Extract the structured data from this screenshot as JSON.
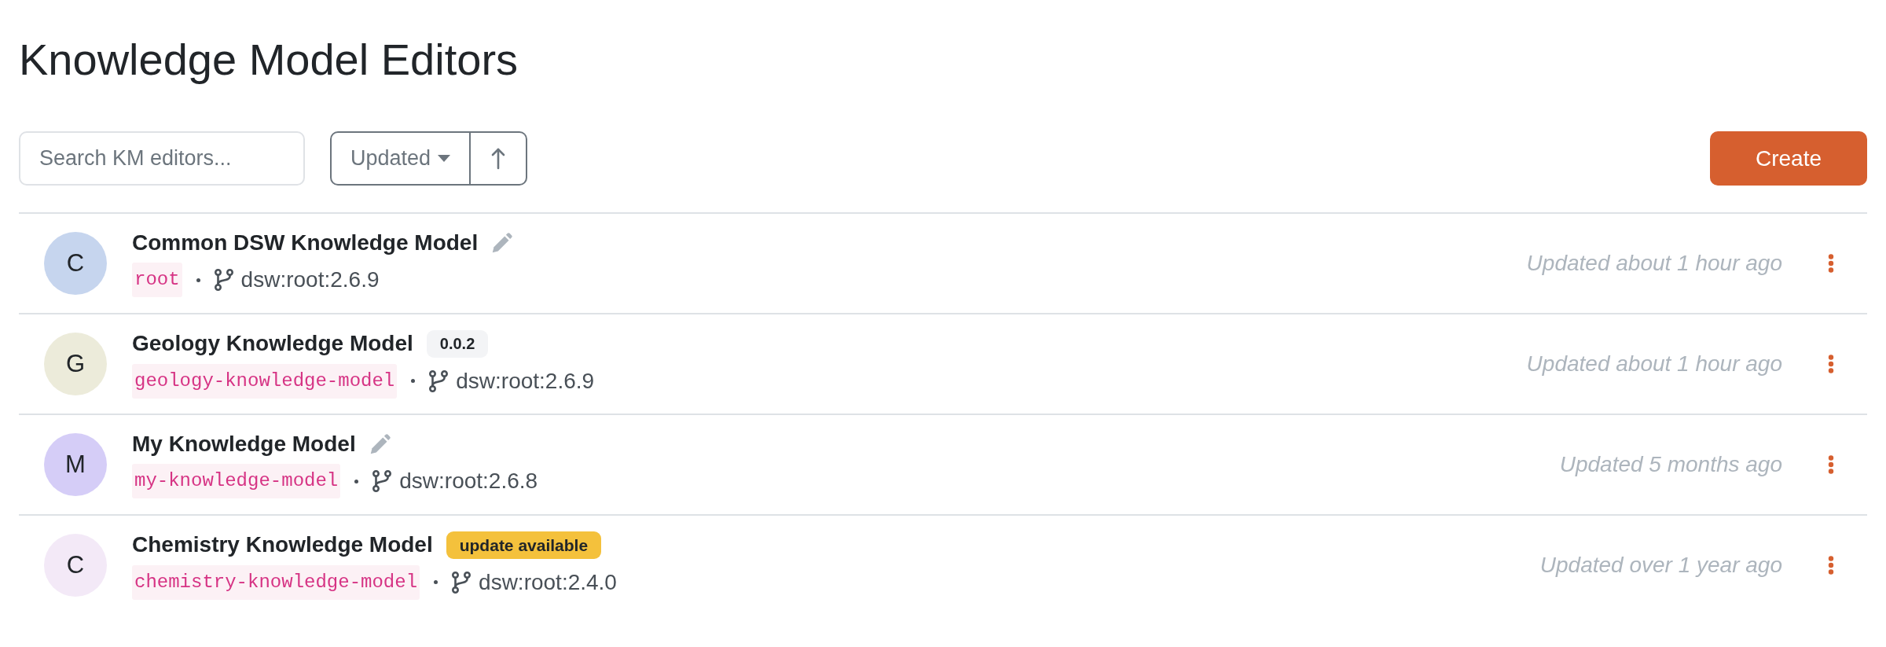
{
  "page_title": "Knowledge Model Editors",
  "toolbar": {
    "search": {
      "placeholder": "Search KM editors..."
    },
    "sort": {
      "field": "Updated"
    },
    "create_button": "Create"
  },
  "editors": [
    {
      "initial": "C",
      "color": "#c6d5ee",
      "name": "Common DSW Knowledge Model",
      "edited": true,
      "km_id": "root",
      "parent": "dsw:root:2.6.9",
      "updated": "Updated about 1 hour ago"
    },
    {
      "initial": "G",
      "color": "#ecebda",
      "name": "Geology Knowledge Model",
      "edited": false,
      "badge": {
        "kind": "version",
        "text": "0.0.2"
      },
      "km_id": "geology-knowledge-model",
      "parent": "dsw:root:2.6.9",
      "updated": "Updated about 1 hour ago"
    },
    {
      "initial": "M",
      "color": "#d5cdf7",
      "name": "My Knowledge Model",
      "edited": true,
      "km_id": "my-knowledge-model",
      "parent": "dsw:root:2.6.8",
      "updated": "Updated 5 months ago"
    },
    {
      "initial": "C",
      "color": "#f3e9f7",
      "name": "Chemistry Knowledge Model",
      "edited": false,
      "badge": {
        "kind": "warning",
        "text": "update available"
      },
      "km_id": "chemistry-knowledge-model",
      "parent": "dsw:root:2.4.0",
      "updated": "Updated over 1 year ago"
    }
  ]
}
